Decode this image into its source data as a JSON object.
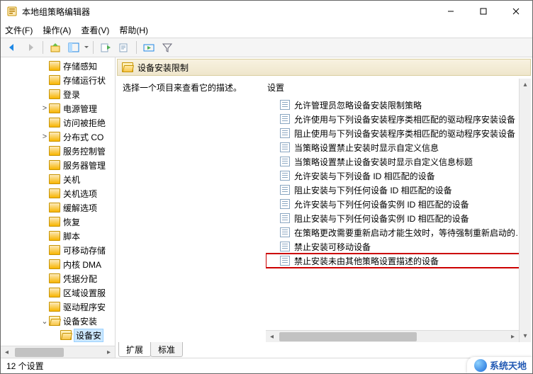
{
  "window": {
    "title": "本地组策略编辑器"
  },
  "menu": {
    "file": "文件(F)",
    "action": "操作(A)",
    "view": "查看(V)",
    "help": "帮助(H)"
  },
  "tree": [
    {
      "label": "存储感知",
      "depth": 3,
      "children": false
    },
    {
      "label": "存储运行状",
      "depth": 3,
      "children": false
    },
    {
      "label": "登录",
      "depth": 3,
      "children": false
    },
    {
      "label": "电源管理",
      "depth": 3,
      "children": true,
      "expanded": false
    },
    {
      "label": "访问被拒绝",
      "depth": 3,
      "children": false
    },
    {
      "label": "分布式 CO",
      "depth": 3,
      "children": true,
      "expanded": false
    },
    {
      "label": "服务控制管",
      "depth": 3,
      "children": false
    },
    {
      "label": "服务器管理",
      "depth": 3,
      "children": false
    },
    {
      "label": "关机",
      "depth": 3,
      "children": false
    },
    {
      "label": "关机选项",
      "depth": 3,
      "children": false
    },
    {
      "label": "缓解选项",
      "depth": 3,
      "children": false
    },
    {
      "label": "恢复",
      "depth": 3,
      "children": false
    },
    {
      "label": "脚本",
      "depth": 3,
      "children": false
    },
    {
      "label": "可移动存储",
      "depth": 3,
      "children": false
    },
    {
      "label": "内核 DMA",
      "depth": 3,
      "children": false
    },
    {
      "label": "凭据分配",
      "depth": 3,
      "children": false
    },
    {
      "label": "区域设置服",
      "depth": 3,
      "children": false
    },
    {
      "label": "驱动程序安",
      "depth": 3,
      "children": false
    },
    {
      "label": "设备安装",
      "depth": 3,
      "children": true,
      "expanded": true
    },
    {
      "label": "设备安",
      "depth": 4,
      "children": false,
      "selected": true
    }
  ],
  "right": {
    "header": "设备安装限制",
    "desc_prompt": "选择一个项目来查看它的描述。",
    "col_header": "设置",
    "settings": [
      "允许管理员忽略设备安装限制策略",
      "允许使用与下列设备安装程序类相匹配的驱动程序安装设备",
      "阻止使用与下列设备安装程序类相匹配的驱动程序安装设备",
      "当策略设置禁止安装时显示自定义信息",
      "当策略设置禁止设备安装时显示自定义信息标题",
      "允许安装与下列设备 ID 相匹配的设备",
      "阻止安装与下列任何设备 ID 相匹配的设备",
      "允许安装与下列任何设备实例 ID 相匹配的设备",
      "阻止安装与下列任何设备实例 ID 相匹配的设备",
      "在策略更改需要重新启动才能生效时，等待强制重新启动的…",
      "禁止安装可移动设备",
      "禁止安装未由其他策略设置描述的设备"
    ],
    "highlight_index": 11
  },
  "tabs": {
    "extended": "扩展",
    "standard": "标准"
  },
  "statusbar": {
    "text": "12 个设置"
  },
  "watermark": {
    "text": "系统天地"
  }
}
